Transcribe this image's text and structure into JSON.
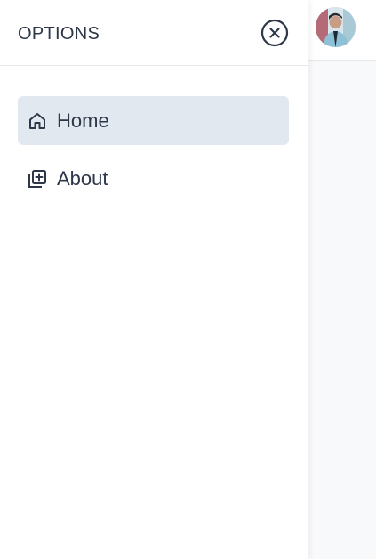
{
  "drawer": {
    "title": "OPTIONS",
    "close_icon": "close-circle-icon",
    "items": [
      {
        "label": "Home",
        "icon": "home-icon",
        "active": true
      },
      {
        "label": "About",
        "icon": "add-box-icon",
        "active": false
      }
    ]
  },
  "topbar": {
    "avatar": "user-avatar"
  },
  "colors": {
    "text": "#2d3748",
    "active_bg": "#e2e8f0",
    "backdrop": "#f8f9fb"
  }
}
